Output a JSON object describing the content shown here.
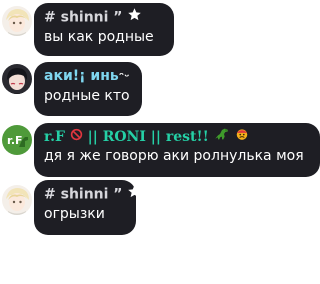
{
  "messages": [
    {
      "avatar": "anime-blonde-avatar",
      "name": "# shinni ”",
      "text": "вы как родные"
    },
    {
      "avatar": "anime-dark-avatar",
      "name": "аки!¡ инь",
      "name_deco": "ᵔᵕ",
      "text": "родные кто"
    },
    {
      "avatar": "green-dino-avatar",
      "name": "r.F",
      "name_mid": " || RONI || rest!!",
      "text": "дя я же говорю аки ролнулька моя"
    },
    {
      "avatar": "anime-blonde-avatar",
      "name": "# shinni ”",
      "text": "огрызки"
    }
  ],
  "colors": {
    "bubble": "#1e1e24",
    "name_grey": "#d7d7dc",
    "name_blue": "#7fd6ef",
    "name_green": "#25d0a6",
    "text": "#ffffff"
  }
}
